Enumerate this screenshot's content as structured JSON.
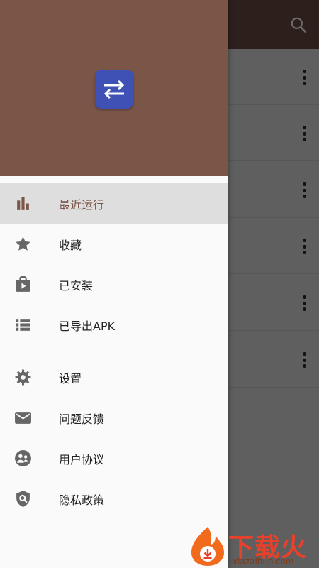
{
  "background_app": {
    "toolbar_icon": "search-icon",
    "row_action_icon": "more-vert-icon",
    "row_count": 6
  },
  "drawer": {
    "header_color": "#7b5547",
    "app_icon": "swap-arrows-icon",
    "primary_items": [
      {
        "label": "最近运行",
        "icon": "bar-chart-icon",
        "active": true
      },
      {
        "label": "收藏",
        "icon": "star-icon",
        "active": false
      },
      {
        "label": "已安装",
        "icon": "play-bag-icon",
        "active": false
      },
      {
        "label": "已导出APK",
        "icon": "list-icon",
        "active": false
      }
    ],
    "secondary_items": [
      {
        "label": "设置",
        "icon": "gear-icon"
      },
      {
        "label": "问题反馈",
        "icon": "mail-icon"
      },
      {
        "label": "用户协议",
        "icon": "people-icon"
      },
      {
        "label": "隐私政策",
        "icon": "shield-search-icon"
      }
    ]
  },
  "watermark": {
    "title": "下载火",
    "subtitle": "xiazaihuo.com"
  },
  "colors": {
    "accent": "#7b5547",
    "app_icon_bg": "#3f51b5",
    "active_item_bg": "#dedede",
    "icon_grey": "#666666",
    "watermark_red": "#e8412b"
  }
}
